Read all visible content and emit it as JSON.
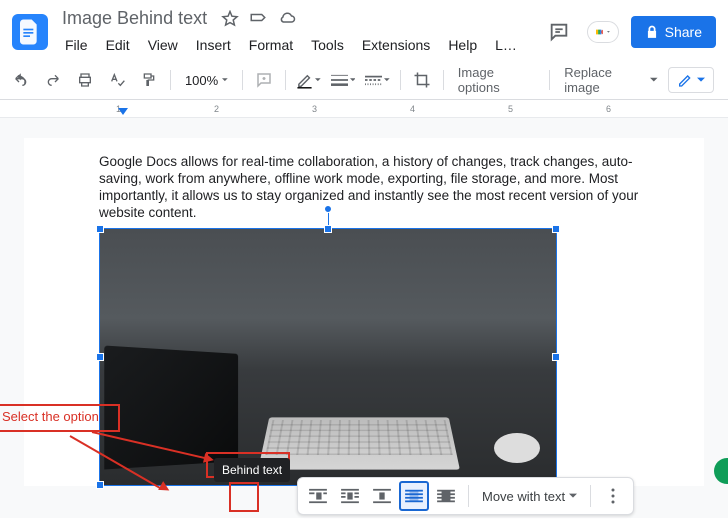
{
  "header": {
    "doc_title": "Image Behind text",
    "star_tooltip": "Star",
    "move_tooltip": "Move",
    "cloud_tooltip": "See document status",
    "share_label": "Share",
    "menus": [
      "File",
      "Edit",
      "View",
      "Insert",
      "Format",
      "Tools",
      "Extensions",
      "Help",
      "L…"
    ]
  },
  "toolbar": {
    "zoom": "100%",
    "image_options": "Image options",
    "replace_image": "Replace image"
  },
  "ruler": {
    "marks": [
      "1",
      "2",
      "3",
      "4",
      "5",
      "6"
    ]
  },
  "document": {
    "body_text": "Google Docs allows for real-time collaboration, a history of changes, track changes, auto-saving, work from anywhere, offline work mode, exporting, file storage, and more. Most importantly, it allows us to stay organized and instantly see the most recent version of your website content."
  },
  "image_toolbar": {
    "wrap_options": [
      "inline",
      "wrap",
      "break",
      "behind",
      "infront"
    ],
    "active_index": 3,
    "tooltip": "Behind text",
    "move_label": "Move with text"
  },
  "annotation": {
    "label": "Select the option"
  }
}
